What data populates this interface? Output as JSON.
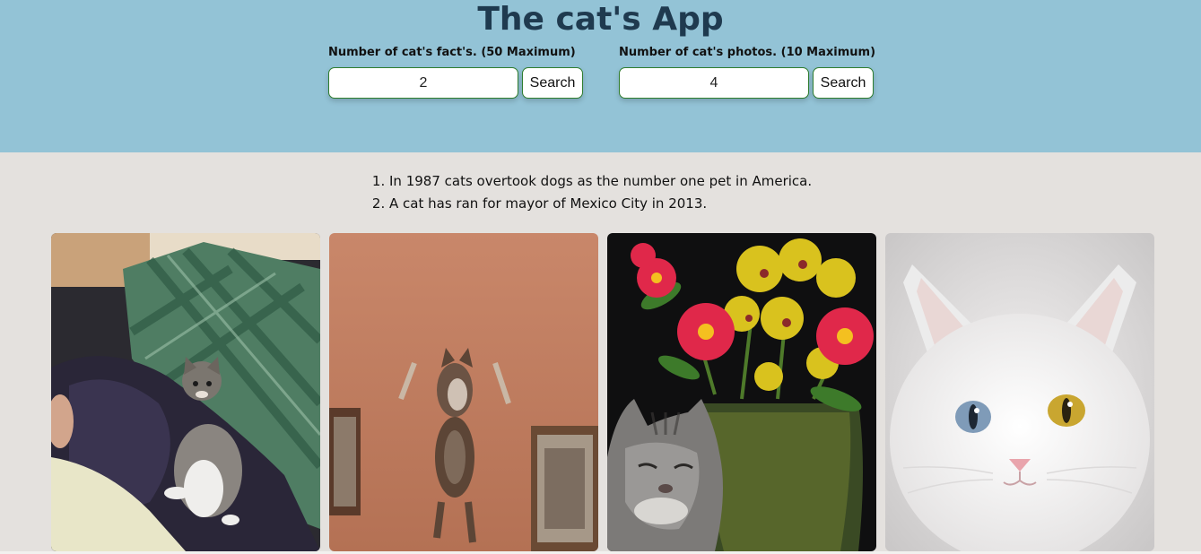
{
  "header": {
    "title": "The cat's App"
  },
  "facts_form": {
    "label": "Number of cat's fact's. (50 Maximum)",
    "value": "2",
    "button_label": "Search"
  },
  "photos_form": {
    "label": "Number of cat's photos. (10 Maximum)",
    "value": "4",
    "button_label": "Search"
  },
  "facts": [
    "In 1987 cats overtook dogs as the number one pet in America.",
    "A cat has ran for mayor of Mexico City in 2013."
  ],
  "photos": [
    {
      "subject": "tabby kitten on green plaid couch"
    },
    {
      "subject": "cat leaping against a wall"
    },
    {
      "subject": "grey cat beside vase of flowers"
    },
    {
      "subject": "white cat with heterochromatic eyes"
    }
  ],
  "colors": {
    "header_bg": "#93c3d6",
    "page_bg": "#e4e1de",
    "title": "#1f3a4f",
    "input_border": "#2f7d2f"
  }
}
